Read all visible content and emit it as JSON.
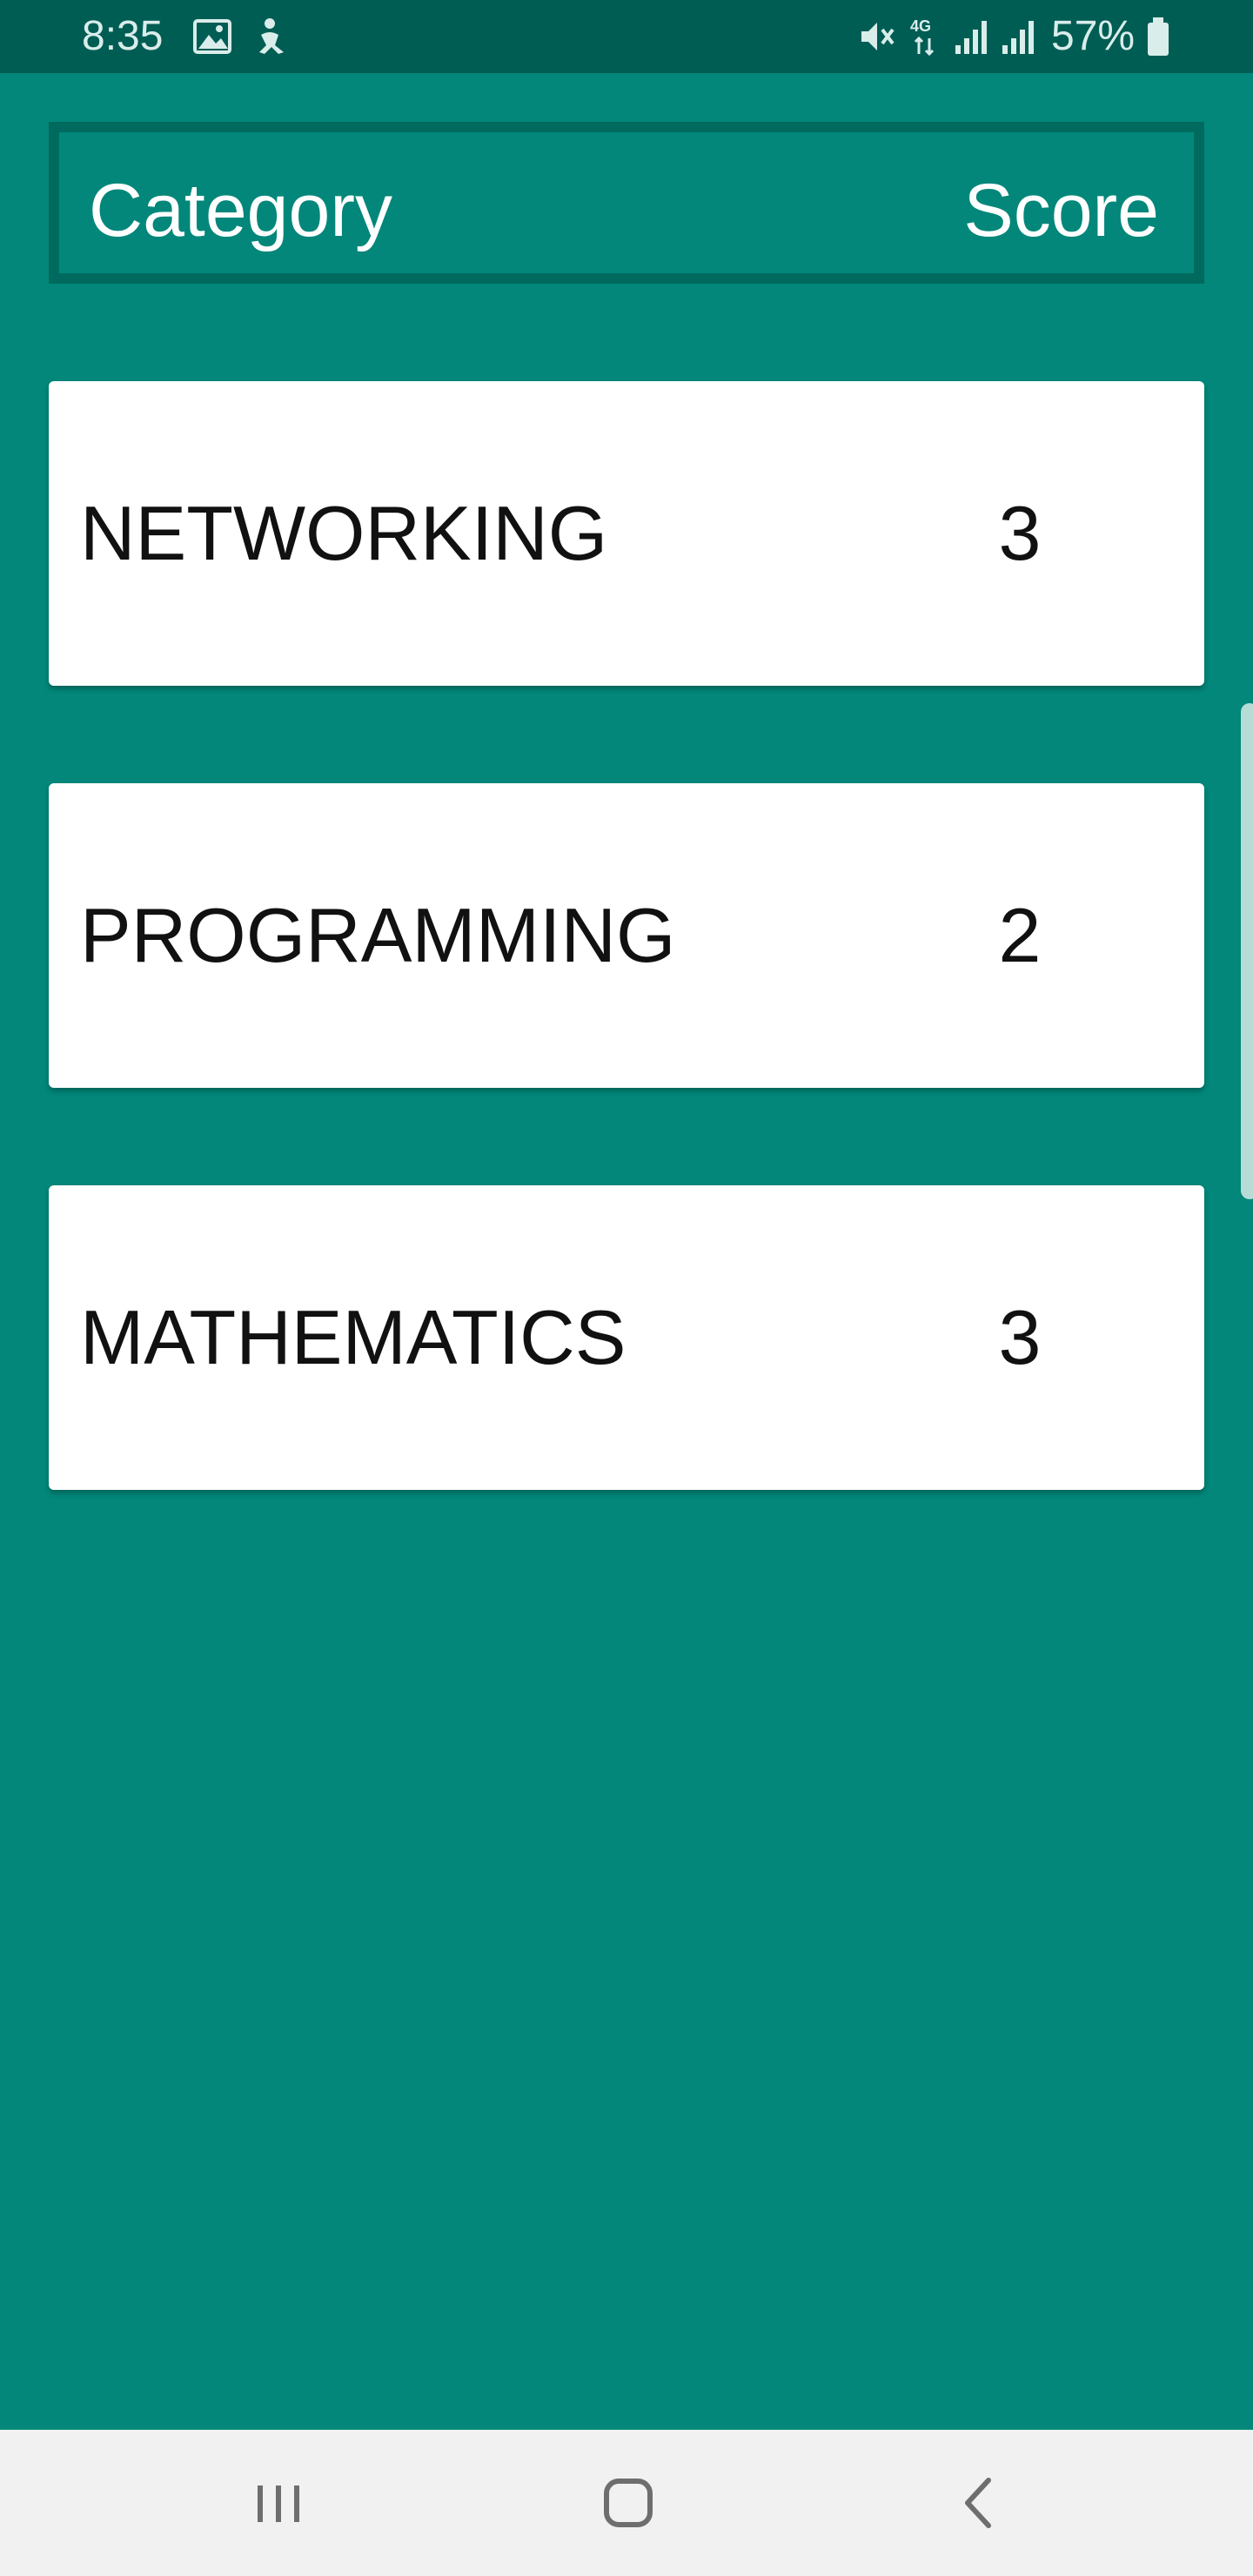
{
  "status_bar": {
    "time": "8:35",
    "battery_percent": "57%",
    "icons": [
      "image-icon",
      "accessibility-icon",
      "mute-icon",
      "4g-icon",
      "signal-icon",
      "signal-icon",
      "battery-icon"
    ]
  },
  "header": {
    "category_label": "Category",
    "score_label": "Score"
  },
  "scores": [
    {
      "category": "NETWORKING",
      "score": "3"
    },
    {
      "category": "PROGRAMMING",
      "score": "2"
    },
    {
      "category": "MATHEMATICS",
      "score": "3"
    }
  ],
  "nav_bar": {
    "buttons": [
      "recent-apps-icon",
      "home-icon",
      "back-icon"
    ]
  },
  "colors": {
    "background": "#02877A",
    "status_bar": "#005D54",
    "header_border": "#006A5F",
    "card": "#FFFFFF",
    "nav_bar": "#F1F1F1"
  }
}
